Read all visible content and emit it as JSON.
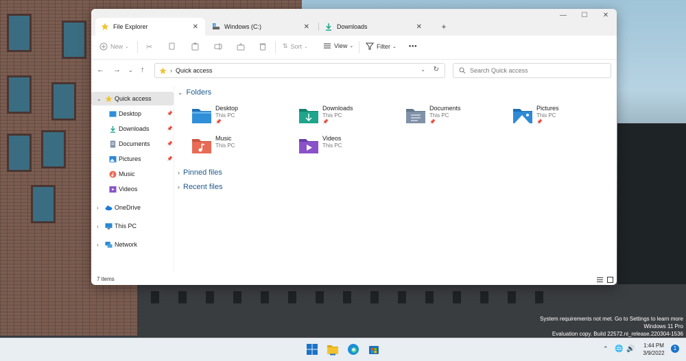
{
  "window": {
    "tabs": [
      {
        "label": "File Explorer",
        "icon": "star-icon"
      },
      {
        "label": "Windows (C:)",
        "icon": "drive-icon"
      },
      {
        "label": "Downloads",
        "icon": "download-icon"
      }
    ],
    "new_tab_glyph": "+",
    "controls": {
      "minimize": "—",
      "maximize": "☐",
      "close": "✕"
    }
  },
  "toolbar": {
    "new": "New",
    "sort": "Sort",
    "view": "View",
    "filter": "Filter",
    "more": "•••"
  },
  "address": {
    "path": "Quick access",
    "search_placeholder": "Search Quick access"
  },
  "sidebar": {
    "items": [
      {
        "label": "Quick access",
        "icon": "star-icon",
        "pinned": false
      },
      {
        "label": "Desktop",
        "icon": "desktop-folder-icon",
        "pinned": true
      },
      {
        "label": "Downloads",
        "icon": "download-icon",
        "pinned": true
      },
      {
        "label": "Documents",
        "icon": "documents-icon",
        "pinned": true
      },
      {
        "label": "Pictures",
        "icon": "pictures-icon",
        "pinned": true
      },
      {
        "label": "Music",
        "icon": "music-icon",
        "pinned": false
      },
      {
        "label": "Videos",
        "icon": "videos-icon",
        "pinned": false
      },
      {
        "label": "OneDrive",
        "icon": "cloud-icon",
        "pinned": false
      },
      {
        "label": "This PC",
        "icon": "pc-icon",
        "pinned": false
      },
      {
        "label": "Network",
        "icon": "network-icon",
        "pinned": false
      }
    ]
  },
  "content": {
    "folders_heading": "Folders",
    "folders": [
      {
        "name": "Desktop",
        "location": "This PC",
        "pinned": true,
        "color": "#2f8fd8"
      },
      {
        "name": "Downloads",
        "location": "This PC",
        "pinned": true,
        "color": "#1ea58c"
      },
      {
        "name": "Documents",
        "location": "This PC",
        "pinned": true,
        "color": "#8092a8"
      },
      {
        "name": "Pictures",
        "location": "This PC",
        "pinned": true,
        "color": "#2e8ad6"
      },
      {
        "name": "Music",
        "location": "This PC",
        "pinned": false,
        "color": "#e86b55"
      },
      {
        "name": "Videos",
        "location": "This PC",
        "pinned": false,
        "color": "#8a52c9"
      }
    ],
    "pinned_files": "Pinned files",
    "recent_files": "Recent files"
  },
  "status": {
    "items_count": "7 items"
  },
  "watermark": {
    "line1": "System requirements not met. Go to Settings to learn more",
    "line2": "Windows 11 Pro",
    "line3": "Evaluation copy. Build 22572.ni_release.220304-1536"
  },
  "taskbar": {
    "time": "1:44 PM",
    "date": "3/9/2022",
    "notifications": "1"
  },
  "colors": {
    "accent": "#1d5a8c",
    "folder_yellow": "#f2c231"
  }
}
